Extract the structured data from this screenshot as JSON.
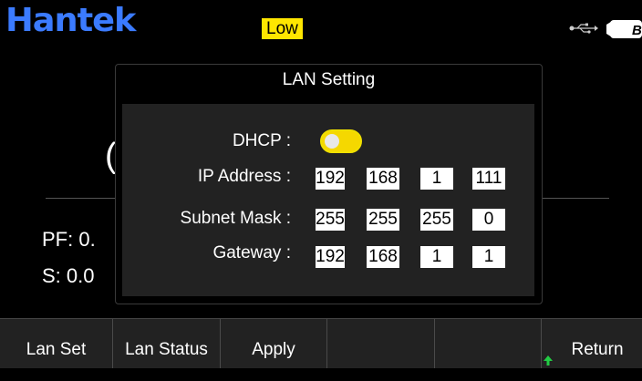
{
  "header": {
    "logo": "Hantek",
    "mode_badge": "Low",
    "battery_label": "B"
  },
  "background": {
    "paren": "(",
    "pf": "PF: 0.",
    "s": "S: 0.0"
  },
  "dialog": {
    "title": "LAN Setting",
    "dhcp_label": "DHCP :",
    "dhcp_enabled": false,
    "ip_label": "IP Address :",
    "ip": [
      "192",
      "168",
      "1",
      "111"
    ],
    "mask_label": "Subnet Mask :",
    "mask": [
      "255",
      "255",
      "255",
      "0"
    ],
    "gateway_label": "Gateway :",
    "gateway": [
      "192",
      "168",
      "1",
      "1"
    ]
  },
  "softkeys": [
    "Lan Set",
    "Lan Status",
    "Apply",
    "",
    "",
    "Return"
  ],
  "colors": {
    "logo": "#3b7bff",
    "badge": "#ffe600",
    "toggle": "#f5d800",
    "return_arrow": "#22cc44"
  }
}
